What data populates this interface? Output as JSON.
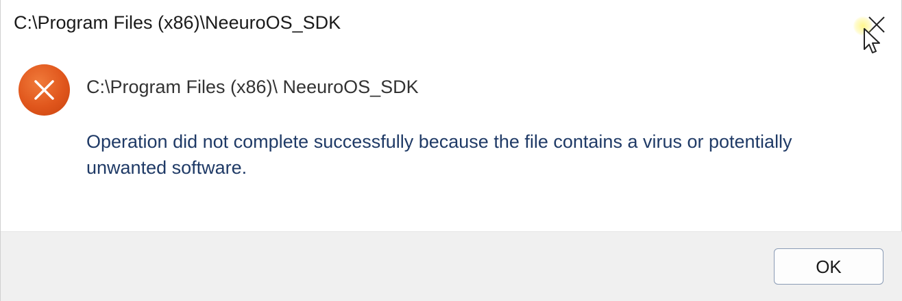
{
  "window": {
    "title": "C:\\Program Files (x86)\\NeeuroOS_SDK",
    "close_icon": "close-icon"
  },
  "dialog": {
    "icon": "error-circle-x-icon",
    "icon_color": "#e0561c",
    "heading": "C:\\Program Files (x86)\\ NeeuroOS_SDK",
    "message_line1": "Operation did not complete successfully because the file contains a virus or potentially",
    "message_line2": "unwanted software."
  },
  "footer": {
    "ok_label": "OK"
  },
  "colors": {
    "message_text": "#1f3a66",
    "footer_bg": "#f0f0f0",
    "button_border": "#8a9bb5"
  }
}
